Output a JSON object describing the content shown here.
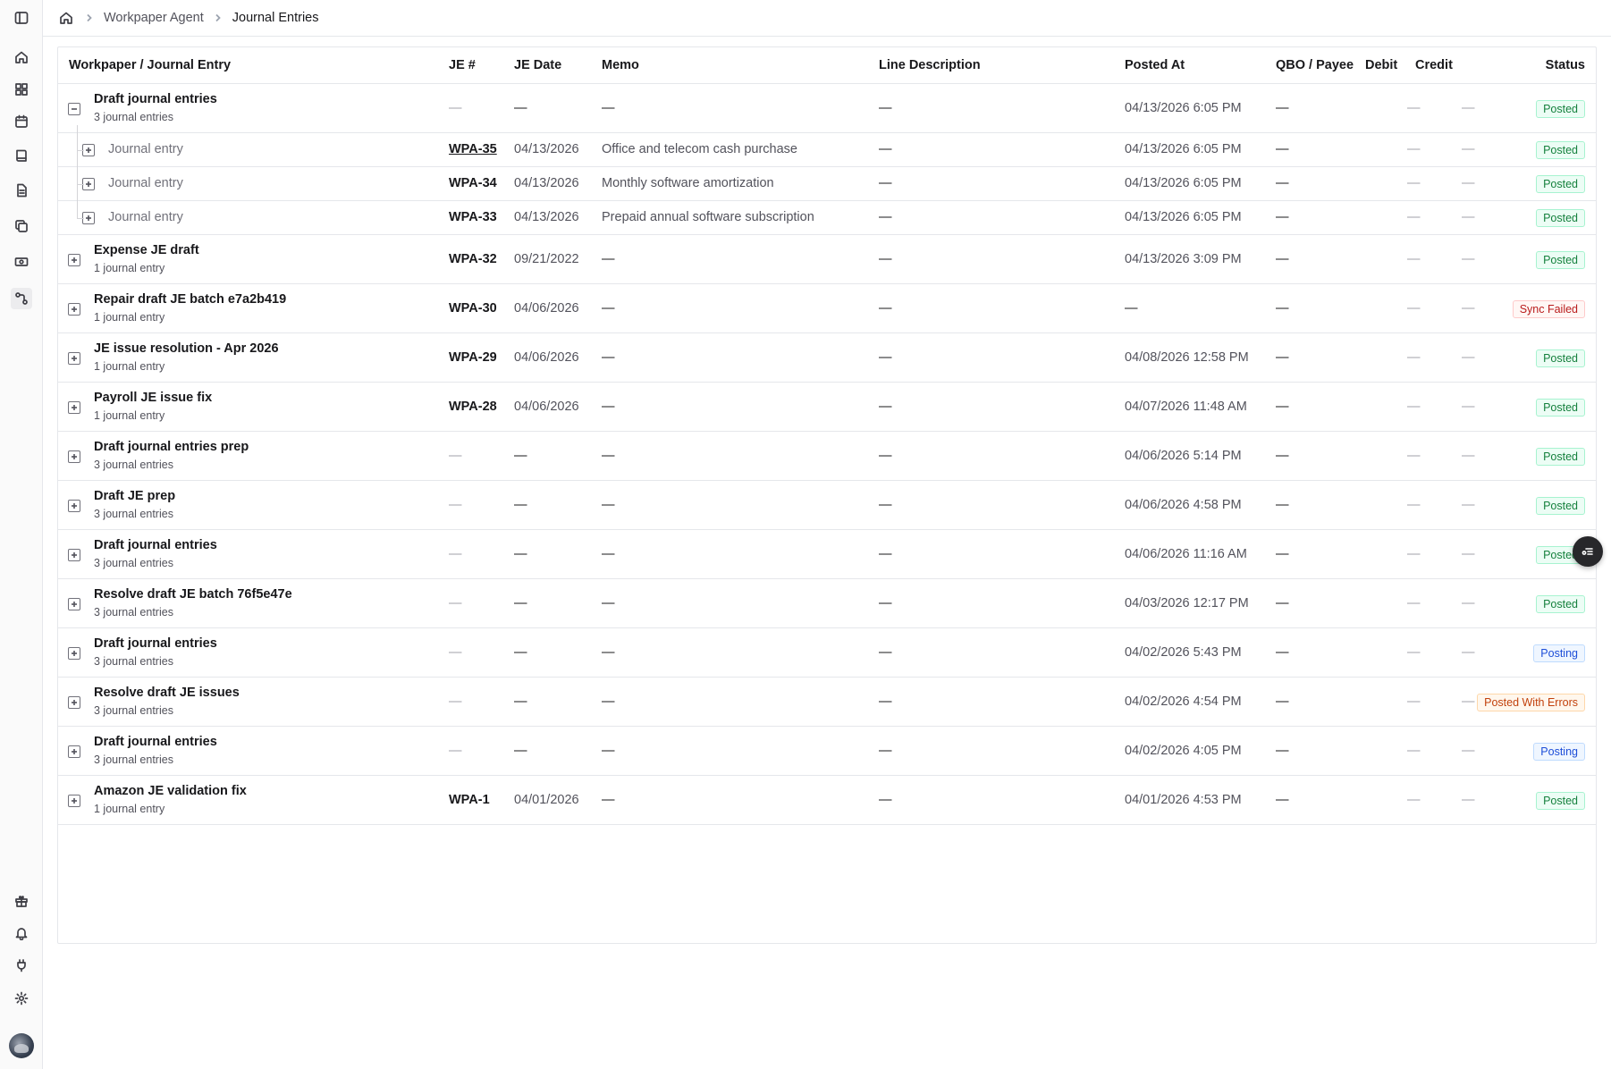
{
  "breadcrumb": {
    "parent": "Workpaper Agent",
    "current": "Journal Entries"
  },
  "columns": {
    "entry": "Workpaper / Journal Entry",
    "je_num": "JE #",
    "je_date": "JE Date",
    "memo": "Memo",
    "line_desc": "Line Description",
    "posted_at": "Posted At",
    "qbo": "QBO / Payee",
    "debit": "Debit",
    "credit": "Credit",
    "status": "Status"
  },
  "dash": "—",
  "rows": [
    {
      "title": "Draft journal entries",
      "sub": "3 journal entries",
      "je": "—",
      "date": "—",
      "memo": "—",
      "line": "—",
      "posted": "04/13/2026 6:05 PM",
      "qbo": "—",
      "debit": "—",
      "credit": "—",
      "status": "Posted",
      "expanded": true
    },
    {
      "child": true,
      "title": "Journal entry",
      "je": "WPA-35",
      "date": "04/13/2026",
      "memo": "Office and telecom cash purchase",
      "line": "—",
      "posted": "04/13/2026 6:05 PM",
      "qbo": "—",
      "debit": "—",
      "credit": "—",
      "status": "Posted"
    },
    {
      "child": true,
      "title": "Journal entry",
      "je": "WPA-34",
      "date": "04/13/2026",
      "memo": "Monthly software amortization",
      "line": "—",
      "posted": "04/13/2026 6:05 PM",
      "qbo": "—",
      "debit": "—",
      "credit": "—",
      "status": "Posted"
    },
    {
      "child": true,
      "title": "Journal entry",
      "je": "WPA-33",
      "date": "04/13/2026",
      "memo": "Prepaid annual software subscription",
      "line": "—",
      "posted": "04/13/2026 6:05 PM",
      "qbo": "—",
      "debit": "—",
      "credit": "—",
      "status": "Posted"
    },
    {
      "title": "Expense JE draft",
      "sub": "1 journal entry",
      "je": "WPA-32",
      "date": "09/21/2022",
      "memo": "—",
      "line": "—",
      "posted": "04/13/2026 3:09 PM",
      "qbo": "—",
      "debit": "—",
      "credit": "—",
      "status": "Posted"
    },
    {
      "title": "Repair draft JE batch e7a2b419",
      "sub": "1 journal entry",
      "je": "WPA-30",
      "date": "04/06/2026",
      "memo": "—",
      "line": "—",
      "posted": "—",
      "qbo": "—",
      "debit": "—",
      "credit": "—",
      "status": "Sync Failed"
    },
    {
      "title": "JE issue resolution - Apr 2026",
      "sub": "1 journal entry",
      "je": "WPA-29",
      "date": "04/06/2026",
      "memo": "—",
      "line": "—",
      "posted": "04/08/2026 12:58 PM",
      "qbo": "—",
      "debit": "—",
      "credit": "—",
      "status": "Posted"
    },
    {
      "title": "Payroll JE issue fix",
      "sub": "1 journal entry",
      "je": "WPA-28",
      "date": "04/06/2026",
      "memo": "—",
      "line": "—",
      "posted": "04/07/2026 11:48 AM",
      "qbo": "—",
      "debit": "—",
      "credit": "—",
      "status": "Posted"
    },
    {
      "title": "Draft journal entries prep",
      "sub": "3 journal entries",
      "je": "—",
      "date": "—",
      "memo": "—",
      "line": "—",
      "posted": "04/06/2026 5:14 PM",
      "qbo": "—",
      "debit": "—",
      "credit": "—",
      "status": "Posted"
    },
    {
      "title": "Draft JE prep",
      "sub": "3 journal entries",
      "je": "—",
      "date": "—",
      "memo": "—",
      "line": "—",
      "posted": "04/06/2026 4:58 PM",
      "qbo": "—",
      "debit": "—",
      "credit": "—",
      "status": "Posted"
    },
    {
      "title": "Draft journal entries",
      "sub": "3 journal entries",
      "je": "—",
      "date": "—",
      "memo": "—",
      "line": "—",
      "posted": "04/06/2026 11:16 AM",
      "qbo": "—",
      "debit": "—",
      "credit": "—",
      "status": "Posted"
    },
    {
      "title": "Resolve draft JE batch 76f5e47e",
      "sub": "3 journal entries",
      "je": "—",
      "date": "—",
      "memo": "—",
      "line": "—",
      "posted": "04/03/2026 12:17 PM",
      "qbo": "—",
      "debit": "—",
      "credit": "—",
      "status": "Posted"
    },
    {
      "title": "Draft journal entries",
      "sub": "3 journal entries",
      "je": "—",
      "date": "—",
      "memo": "—",
      "line": "—",
      "posted": "04/02/2026 5:43 PM",
      "qbo": "—",
      "debit": "—",
      "credit": "—",
      "status": "Posting"
    },
    {
      "title": "Resolve draft JE issues",
      "sub": "3 journal entries",
      "je": "—",
      "date": "—",
      "memo": "—",
      "line": "—",
      "posted": "04/02/2026 4:54 PM",
      "qbo": "—",
      "debit": "—",
      "credit": "—",
      "status": "Posted With Errors"
    },
    {
      "title": "Draft journal entries",
      "sub": "3 journal entries",
      "je": "—",
      "date": "—",
      "memo": "—",
      "line": "—",
      "posted": "04/02/2026 4:05 PM",
      "qbo": "—",
      "debit": "—",
      "credit": "—",
      "status": "Posting"
    },
    {
      "title": "Amazon JE validation fix",
      "sub": "1 journal entry",
      "je": "WPA-1",
      "date": "04/01/2026",
      "memo": "—",
      "line": "—",
      "posted": "04/01/2026 4:53 PM",
      "qbo": "—",
      "debit": "—",
      "credit": "—",
      "status": "Posted"
    }
  ],
  "status_colors": {
    "Posted": "#15803d",
    "Sync Failed": "#b91c1c",
    "Posting": "#1d4ed8",
    "Posted With Errors": "#c2410c"
  },
  "sidebar_icons": [
    "sidebar-toggle-icon",
    "home-icon",
    "dashboard-icon",
    "calendar-icon",
    "book-icon",
    "document-icon",
    "copy-icon",
    "cash-icon",
    "workflow-icon",
    "gift-icon",
    "bell-icon",
    "plug-icon",
    "gear-icon"
  ]
}
